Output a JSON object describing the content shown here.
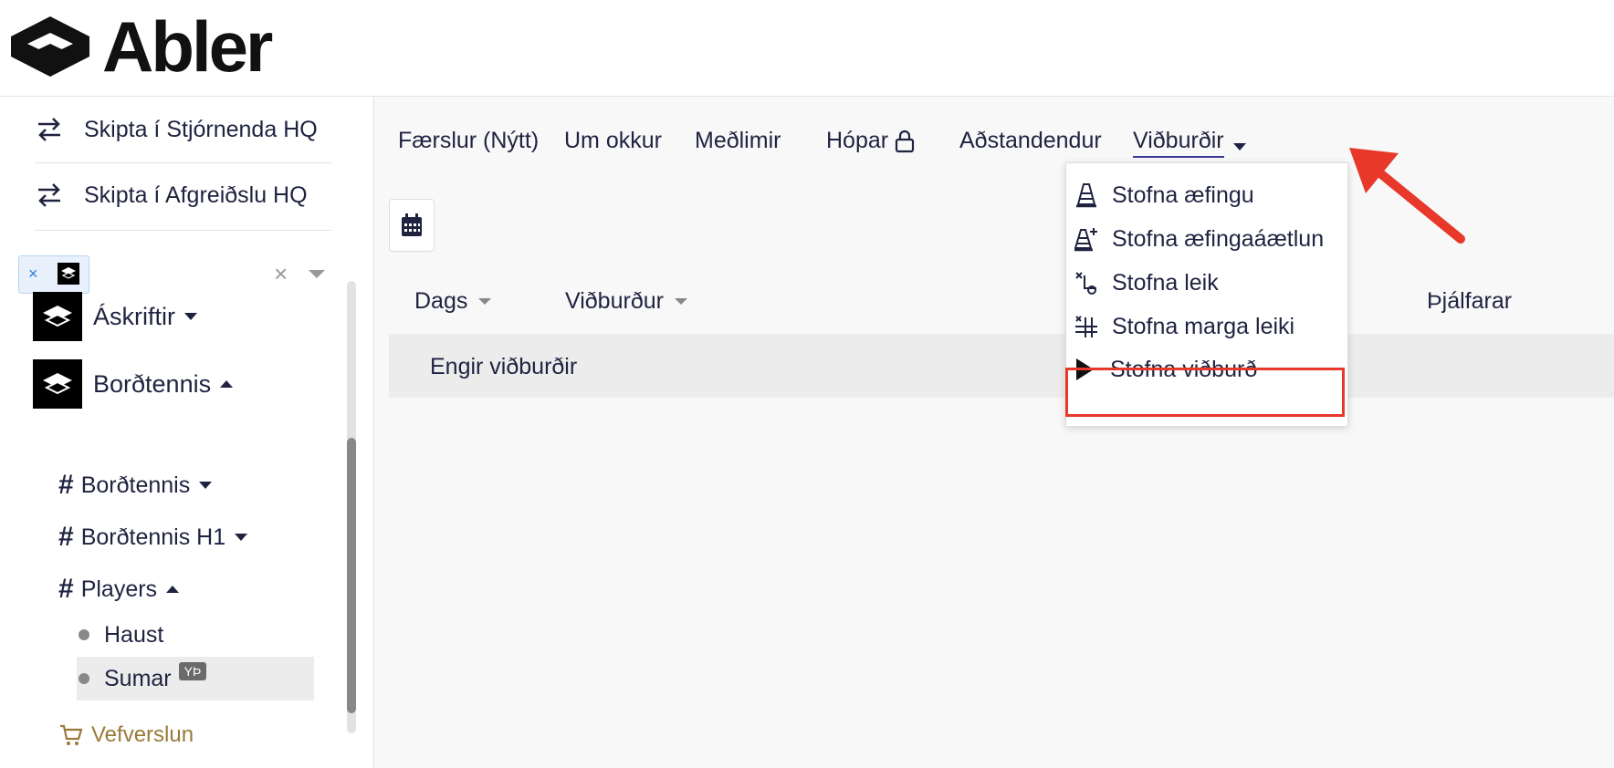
{
  "brand": {
    "name": "Abler"
  },
  "sidebar": {
    "switch_items": [
      {
        "label": "Skipta í Stjórnenda HQ"
      },
      {
        "label": "Skipta í Afgreiðslu HQ"
      }
    ],
    "org_select": {
      "chip_remove": "×",
      "clear": "×"
    },
    "orgs": [
      {
        "label": "Áskriftir"
      },
      {
        "label": "Borðtennis"
      }
    ],
    "groups": [
      {
        "label": "Borðtennis"
      },
      {
        "label": "Borðtennis H1"
      },
      {
        "label": "Players"
      }
    ],
    "subgroups": [
      {
        "label": "Haust"
      },
      {
        "label": "Sumar",
        "badge": "YÞ"
      }
    ],
    "shop": {
      "label": "Vefverslun"
    }
  },
  "nav": {
    "items": [
      {
        "label": "Færslur (Nýtt)"
      },
      {
        "label": "Um okkur"
      },
      {
        "label": "Meðlimir"
      },
      {
        "label": "Hópar"
      },
      {
        "label": "Aðstandendur"
      },
      {
        "label": "Viðburðir"
      }
    ]
  },
  "table": {
    "headers": [
      {
        "label": "Dags"
      },
      {
        "label": "Viðburður"
      },
      {
        "label": "Þjálfarar"
      }
    ],
    "empty_text": "Engir viðburðir"
  },
  "dropdown": {
    "items": [
      {
        "label": "Stofna æfingu",
        "icon": "cone-icon"
      },
      {
        "label": "Stofna æfingaáætlun",
        "icon": "cone-plus-icon"
      },
      {
        "label": "Stofna leik",
        "icon": "tactics-icon"
      },
      {
        "label": "Stofna marga leiki",
        "icon": "tactics-multi-icon"
      },
      {
        "label": "Stofna viðburð",
        "icon": "play-icon"
      }
    ]
  },
  "colors": {
    "highlight": "#e8382a",
    "accent": "#3a3a9a",
    "shop": "#9a7a3a"
  }
}
